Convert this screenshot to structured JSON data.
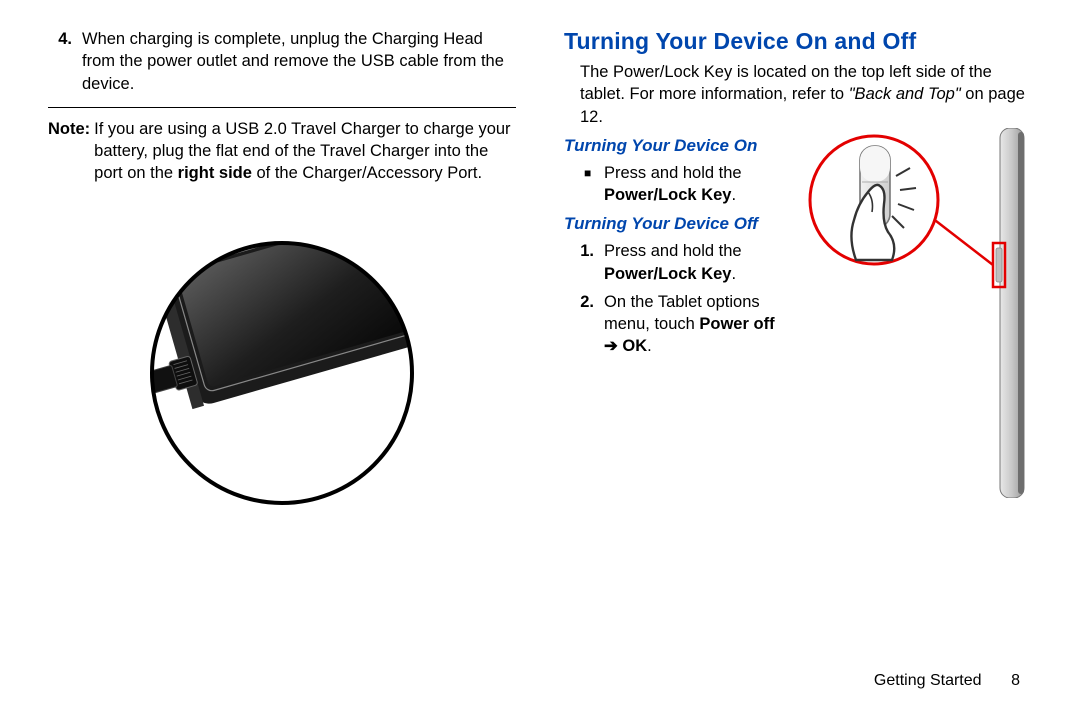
{
  "left": {
    "item4_num": "4.",
    "item4_text": "When charging is complete, unplug the Charging Head from the power outlet and remove the USB cable from the device.",
    "note_label": "Note:",
    "note_pre": "If you are using a USB 2.0 Travel Charger to charge your battery, plug the flat end of the Travel Charger into the port on the ",
    "note_bold": "right side",
    "note_post": " of the Charger/Accessory Port."
  },
  "right": {
    "heading": "Turning Your Device On and Off",
    "intro_pre": "The Power/Lock Key is located on the top left side of the tablet. For more information, refer to ",
    "intro_ref": "\"Back and Top\"",
    "intro_post": " on page 12.",
    "sub_on": "Turning Your Device On",
    "on_bullet_pre": "Press and hold the ",
    "on_bullet_bold": "Power/Lock Key",
    "on_bullet_post": ".",
    "sub_off": "Turning Your Device Off",
    "off1_num": "1.",
    "off1_pre": "Press and hold the ",
    "off1_bold": "Power/Lock Key",
    "off1_post": ".",
    "off2_num": "2.",
    "off2_pre": "On the Tablet options menu, touch ",
    "off2_bold1": "Power off",
    "off2_arrow": " ➔ ",
    "off2_bold2": "OK",
    "off2_post": "."
  },
  "footer": {
    "section": "Getting Started",
    "page": "8"
  },
  "icons": {
    "usb": "usb-port-illustration",
    "power": "power-button-press-illustration"
  }
}
